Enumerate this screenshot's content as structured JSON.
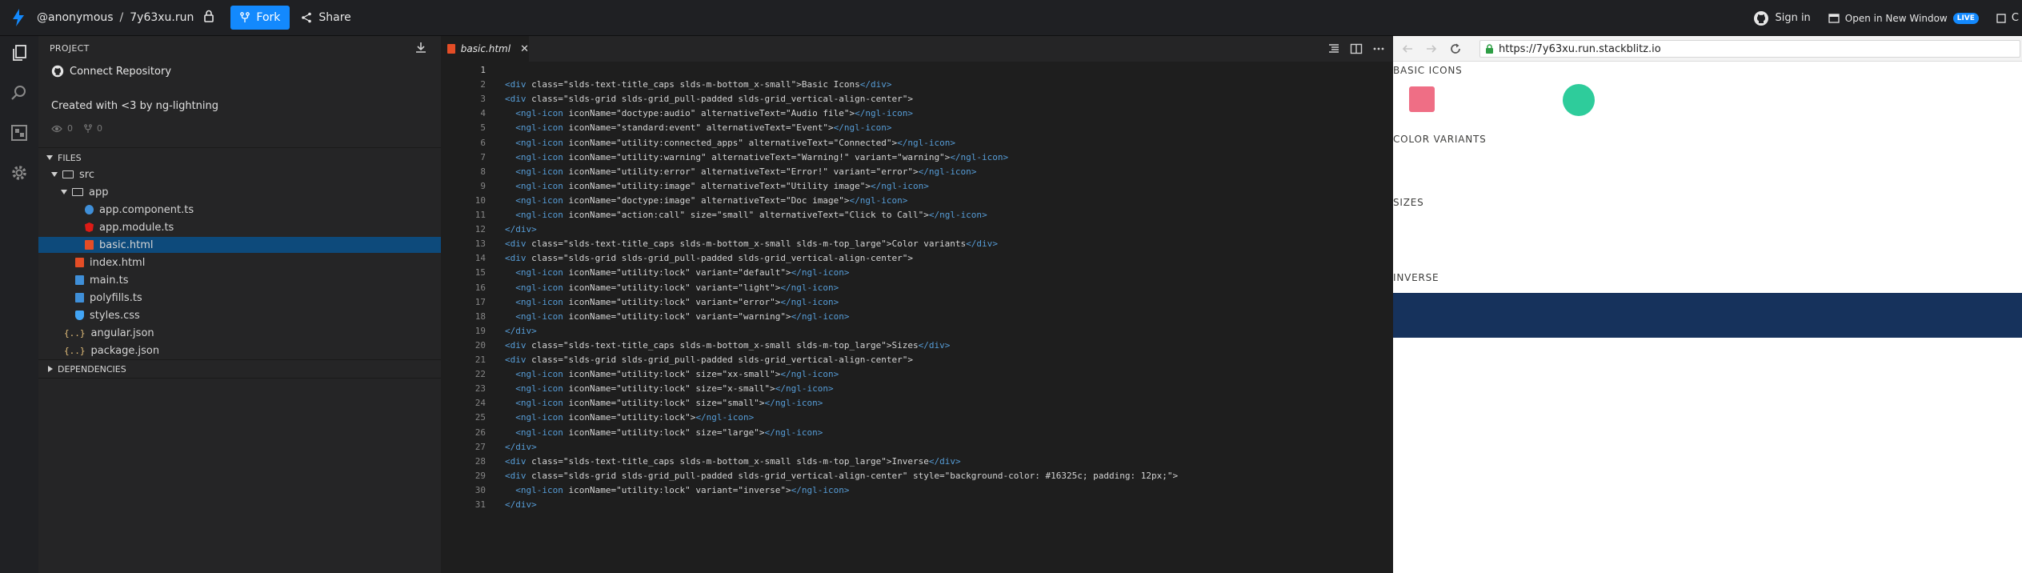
{
  "topbar": {
    "user": "@anonymous",
    "separator": "/",
    "project": "7y63xu.run",
    "fork_label": "Fork",
    "share_label": "Share",
    "sign_in_label": "Sign in",
    "open_new_window_label": "Open in New Window",
    "live_badge": "LIVE",
    "overflow_text": "C"
  },
  "sidebar": {
    "project_heading": "PROJECT",
    "connect_repo_label": "Connect Repository",
    "description": "Created with <3 by ng-lightning",
    "views_count": "0",
    "forks_count": "0",
    "files_heading": "FILES",
    "tree": [
      {
        "label": "src",
        "kind": "folder"
      },
      {
        "label": "app",
        "kind": "folder"
      },
      {
        "label": "app.component.ts",
        "kind": "ts-file"
      },
      {
        "label": "app.module.ts",
        "kind": "angular-file"
      },
      {
        "label": "basic.html",
        "kind": "html-file"
      },
      {
        "label": "index.html",
        "kind": "html-file"
      },
      {
        "label": "main.ts",
        "kind": "ts-file"
      },
      {
        "label": "polyfills.ts",
        "kind": "ts-file"
      },
      {
        "label": "styles.css",
        "kind": "css-file"
      },
      {
        "label": "angular.json",
        "kind": "json-file"
      },
      {
        "label": "package.json",
        "kind": "json-file"
      }
    ],
    "dependencies_heading": "DEPENDENCIES"
  },
  "editor": {
    "tab_label": "basic.html",
    "lines": [
      "",
      "<div class=\"slds-text-title_caps slds-m-bottom_x-small\">Basic Icons</div>",
      "<div class=\"slds-grid slds-grid_pull-padded slds-grid_vertical-align-center\">",
      "  <ngl-icon iconName=\"doctype:audio\" alternativeText=\"Audio file\"></ngl-icon>",
      "  <ngl-icon iconName=\"standard:event\" alternativeText=\"Event\"></ngl-icon>",
      "  <ngl-icon iconName=\"utility:connected_apps\" alternativeText=\"Connected\"></ngl-icon>",
      "  <ngl-icon iconName=\"utility:warning\" alternativeText=\"Warning!\" variant=\"warning\"></ngl-icon>",
      "  <ngl-icon iconName=\"utility:error\" alternativeText=\"Error!\" variant=\"error\"></ngl-icon>",
      "  <ngl-icon iconName=\"utility:image\" alternativeText=\"Utility image\"></ngl-icon>",
      "  <ngl-icon iconName=\"doctype:image\" alternativeText=\"Doc image\"></ngl-icon>",
      "  <ngl-icon iconName=\"action:call\" size=\"small\" alternativeText=\"Click to Call\"></ngl-icon>",
      "</div>",
      "<div class=\"slds-text-title_caps slds-m-bottom_x-small slds-m-top_large\">Color variants</div>",
      "<div class=\"slds-grid slds-grid_pull-padded slds-grid_vertical-align-center\">",
      "  <ngl-icon iconName=\"utility:lock\" variant=\"default\"></ngl-icon>",
      "  <ngl-icon iconName=\"utility:lock\" variant=\"light\"></ngl-icon>",
      "  <ngl-icon iconName=\"utility:lock\" variant=\"error\"></ngl-icon>",
      "  <ngl-icon iconName=\"utility:lock\" variant=\"warning\"></ngl-icon>",
      "</div>",
      "<div class=\"slds-text-title_caps slds-m-bottom_x-small slds-m-top_large\">Sizes</div>",
      "<div class=\"slds-grid slds-grid_pull-padded slds-grid_vertical-align-center\">",
      "  <ngl-icon iconName=\"utility:lock\" size=\"xx-small\"></ngl-icon>",
      "  <ngl-icon iconName=\"utility:lock\" size=\"x-small\"></ngl-icon>",
      "  <ngl-icon iconName=\"utility:lock\" size=\"small\"></ngl-icon>",
      "  <ngl-icon iconName=\"utility:lock\"></ngl-icon>",
      "  <ngl-icon iconName=\"utility:lock\" size=\"large\"></ngl-icon>",
      "</div>",
      "<div class=\"slds-text-title_caps slds-m-bottom_x-small slds-m-top_large\">Inverse</div>",
      "<div class=\"slds-grid slds-grid_pull-padded slds-grid_vertical-align-center\" style=\"background-color: #16325c; padding: 12px;\">",
      "  <ngl-icon iconName=\"utility:lock\" variant=\"inverse\"></ngl-icon>",
      "</div>"
    ]
  },
  "preview": {
    "url": "https://7y63xu.run.stackblitz.io",
    "headings": [
      "BASIC ICONS",
      "COLOR VARIANTS",
      "SIZES",
      "INVERSE"
    ]
  },
  "colors": {
    "accent": "#1389fd",
    "selected_row": "#0d4a7b",
    "inverse_bg": "#16325c",
    "audio_icon": "#ef6e85",
    "event_icon": "#2ecc9b"
  }
}
